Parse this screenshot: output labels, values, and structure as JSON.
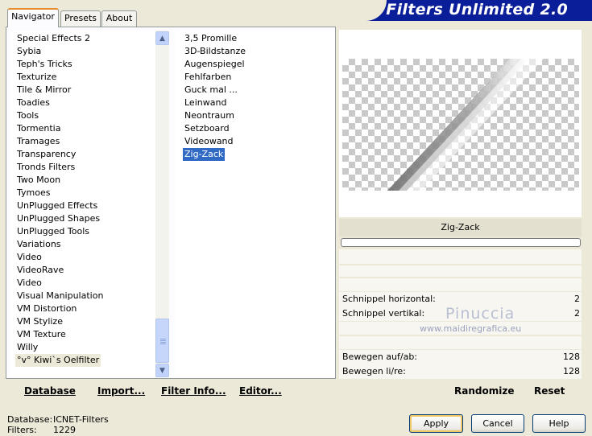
{
  "banner": {
    "title": "Filters Unlimited 2.0"
  },
  "tabs": [
    {
      "label": "Navigator",
      "active": true
    },
    {
      "label": "Presets",
      "active": false
    },
    {
      "label": "About",
      "active": false
    }
  ],
  "categories": [
    "Special Effects 2",
    "Sybia",
    "Teph's Tricks",
    "Texturize",
    "Tile & Mirror",
    "Toadies",
    "Tools",
    "Tormentia",
    "Tramages",
    "Transparency",
    "Tronds Filters",
    "Two Moon",
    "Tymoes",
    "UnPlugged Effects",
    "UnPlugged Shapes",
    "UnPlugged Tools",
    "Variations",
    "Video",
    "VideoRave",
    "Video",
    "Visual Manipulation",
    "VM Distortion",
    "VM Stylize",
    "VM Texture",
    "Willy",
    "°v° Kiwi`s Oelfilter"
  ],
  "selected_category": "°v° Kiwi`s Oelfilter",
  "filters": [
    "3,5 Promille",
    "3D-Bildstanze",
    "Augenspiegel",
    "Fehlfarben",
    "Guck mal ...",
    "Leinwand",
    "Neontraum",
    "Setzboard",
    "Videowand",
    "Zig-Zack"
  ],
  "selected_filter": "Zig-Zack",
  "preview": {
    "filter_name": "Zig-Zack"
  },
  "params": [
    {
      "label": "Schnippel horizontal:",
      "value": "2"
    },
    {
      "label": "Schnippel vertikal:",
      "value": "2"
    },
    {
      "label": "Bewegen auf/ab:",
      "value": "128"
    },
    {
      "label": "Bewegen li/re:",
      "value": "128"
    }
  ],
  "watermark": {
    "name": "Pinuccia",
    "site": "www.maidiregrafica.eu"
  },
  "toolbar": {
    "database": "Database",
    "import": "Import...",
    "filter_info": "Filter Info...",
    "editor": "Editor...",
    "randomize": "Randomize",
    "reset": "Reset"
  },
  "status": {
    "database_label": "Database:",
    "database_value": "ICNET-Filters",
    "filters_label": "Filters:",
    "filters_value": "1229"
  },
  "buttons": {
    "apply": "Apply",
    "cancel": "Cancel",
    "help": "Help"
  },
  "colors": {
    "banner": "#0A1E9A",
    "selection": "#316AC5",
    "tab_highlight": "#E68B2C"
  }
}
